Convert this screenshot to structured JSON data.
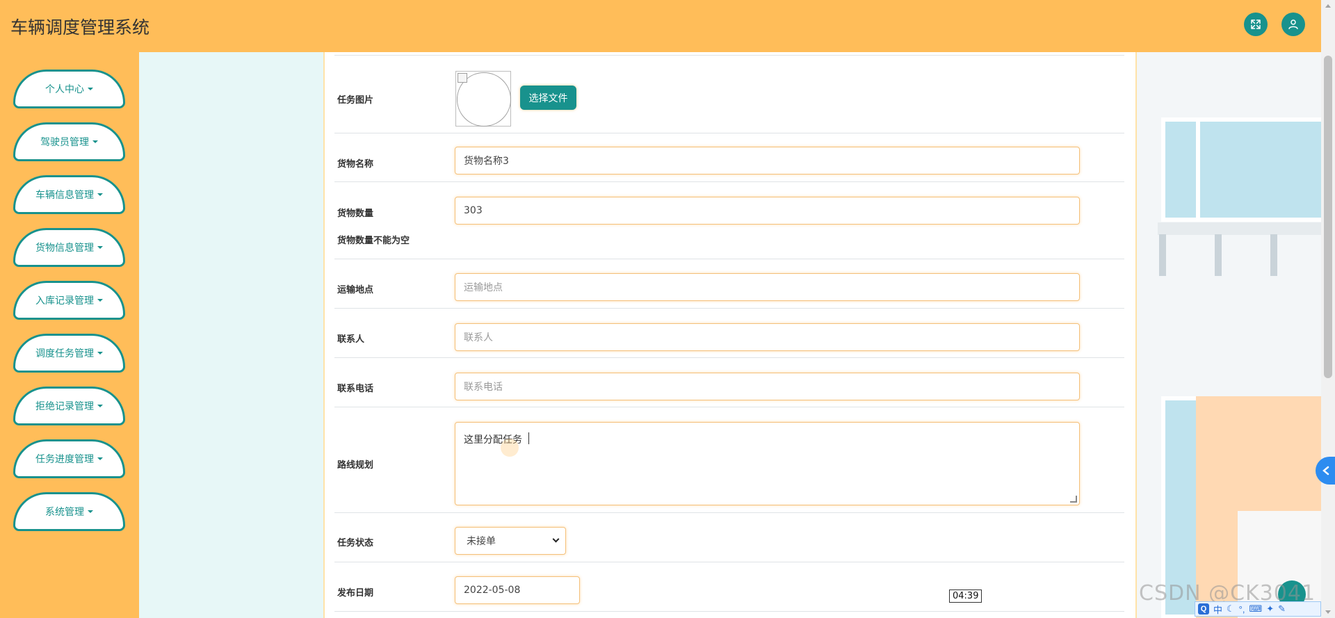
{
  "app": {
    "title": "车辆调度管理系统"
  },
  "header": {
    "fullscreen_icon": "expand-icon",
    "user_icon": "user-icon"
  },
  "sidebar": {
    "items": [
      {
        "label": "个人中心"
      },
      {
        "label": "驾驶员管理"
      },
      {
        "label": "车辆信息管理"
      },
      {
        "label": "货物信息管理"
      },
      {
        "label": "入库记录管理"
      },
      {
        "label": "调度任务管理"
      },
      {
        "label": "拒绝记录管理"
      },
      {
        "label": "任务进度管理"
      },
      {
        "label": "系统管理"
      }
    ]
  },
  "form": {
    "image": {
      "label": "任务图片",
      "button": "选择文件"
    },
    "goods_name": {
      "label": "货物名称",
      "value": "货物名称3"
    },
    "goods_qty": {
      "label": "货物数量",
      "value": "303",
      "error": "货物数量不能为空"
    },
    "location": {
      "label": "运输地点",
      "placeholder": "运输地点"
    },
    "contact": {
      "label": "联系人",
      "placeholder": "联系人"
    },
    "phone": {
      "label": "联系电话",
      "placeholder": "联系电话"
    },
    "route": {
      "label": "路线规划",
      "value": "这里分配任务"
    },
    "status": {
      "label": "任务状态",
      "value": "未接单"
    },
    "date": {
      "label": "发布日期",
      "value": "2022-05-08"
    }
  },
  "overlay": {
    "tooltip_time": "04:39",
    "watermark": "CSDN @CK3041",
    "ime": {
      "q": "Q",
      "lang": "中"
    }
  }
}
